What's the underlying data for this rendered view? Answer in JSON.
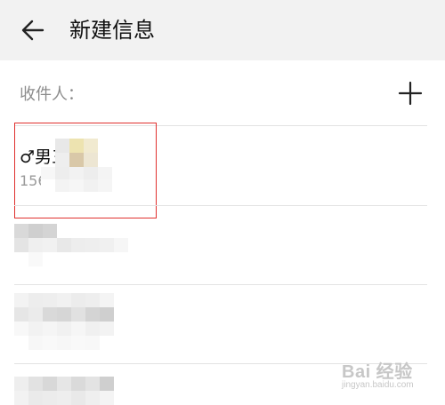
{
  "header": {
    "title": "新建信息",
    "back_icon": "arrow-left-icon"
  },
  "recipient": {
    "label": "收件人：",
    "add_icon": "plus-icon"
  },
  "contacts": [
    {
      "name": "♂男三",
      "phone": "156",
      "selected": true
    },
    {
      "name": "",
      "phone": "",
      "selected": false
    },
    {
      "name": "",
      "phone": "",
      "selected": false
    },
    {
      "name": "",
      "phone": "",
      "selected": false
    }
  ],
  "colors": {
    "header_bg": "#f2f2f2",
    "highlight_border": "#e0302e",
    "divider": "#e3e3e3"
  },
  "watermark": {
    "main": "Bai 经验",
    "sub": "jingyan.baidu.com"
  }
}
